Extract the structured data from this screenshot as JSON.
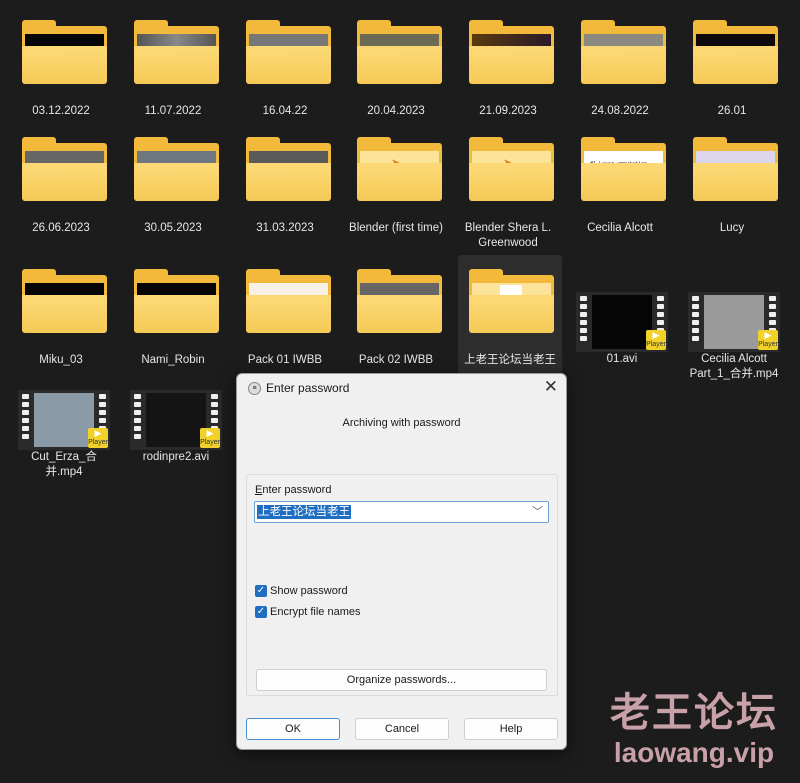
{
  "explorer": {
    "folders": [
      {
        "name": "03.12.2022",
        "thumb": "dark-figure"
      },
      {
        "name": "11.07.2022",
        "thumb": "grey-room"
      },
      {
        "name": "16.04.22",
        "thumb": "grey-room-figure"
      },
      {
        "name": "20.04.2023",
        "thumb": "olive-blur"
      },
      {
        "name": "21.09.2023",
        "thumb": "dark-lights"
      },
      {
        "name": "24.08.2022",
        "thumb": "comic-panel"
      },
      {
        "name": "26.01",
        "thumb": "dark"
      },
      {
        "name": "26.06.2023",
        "thumb": "grey-figure"
      },
      {
        "name": "30.05.2023",
        "thumb": "grey-water"
      },
      {
        "name": "31.03.2023",
        "thumb": "grey"
      },
      {
        "name": "Blender (first time)",
        "thumb": "blender-logo"
      },
      {
        "name": "Blender Shera L. Greenwood",
        "thumb": "blender-logo"
      },
      {
        "name": "Cecilia Alcott",
        "thumb": "document",
        "thumb_text": "#1 Laser amputation"
      },
      {
        "name": "Lucy",
        "thumb": "lavender-figure"
      },
      {
        "name": "Miku_03",
        "thumb": "dark-figure"
      },
      {
        "name": "Nami_Robin",
        "thumb": "dark-figure"
      },
      {
        "name": "Pack 01 IWBB",
        "thumb": "white-blur"
      },
      {
        "name": "Pack 02 IWBB",
        "thumb": "grey-figure"
      },
      {
        "name": "上老王论坛当老王",
        "thumb": "paper",
        "selected": true
      }
    ],
    "videos": [
      {
        "name": "01.avi",
        "badge": "Player"
      },
      {
        "name": "Cecilia Alcott Part_1_合并.mp4",
        "badge": "Player"
      },
      {
        "name": "Cut_Erza_合并.mp4",
        "badge": "Player"
      },
      {
        "name": "rodinpre2.avi",
        "badge": "Player"
      }
    ]
  },
  "dialog": {
    "title": "Enter password",
    "subtitle": "Archiving with password",
    "password_label": "Enter password",
    "password_value": "上老王论坛当老王",
    "show_password": {
      "label": "Show password",
      "checked": true
    },
    "encrypt_names": {
      "label": "Encrypt file names",
      "checked": true
    },
    "organize_button": "Organize passwords...",
    "ok_button": "OK",
    "cancel_button": "Cancel",
    "help_button": "Help"
  },
  "watermark": {
    "cn": "老王论坛",
    "en": "laowang.vip"
  },
  "colors": {
    "background": "#1c1c1c",
    "folder": "#f2b93a",
    "accent": "#1f6ec2",
    "watermark": "#c7a0a8"
  }
}
